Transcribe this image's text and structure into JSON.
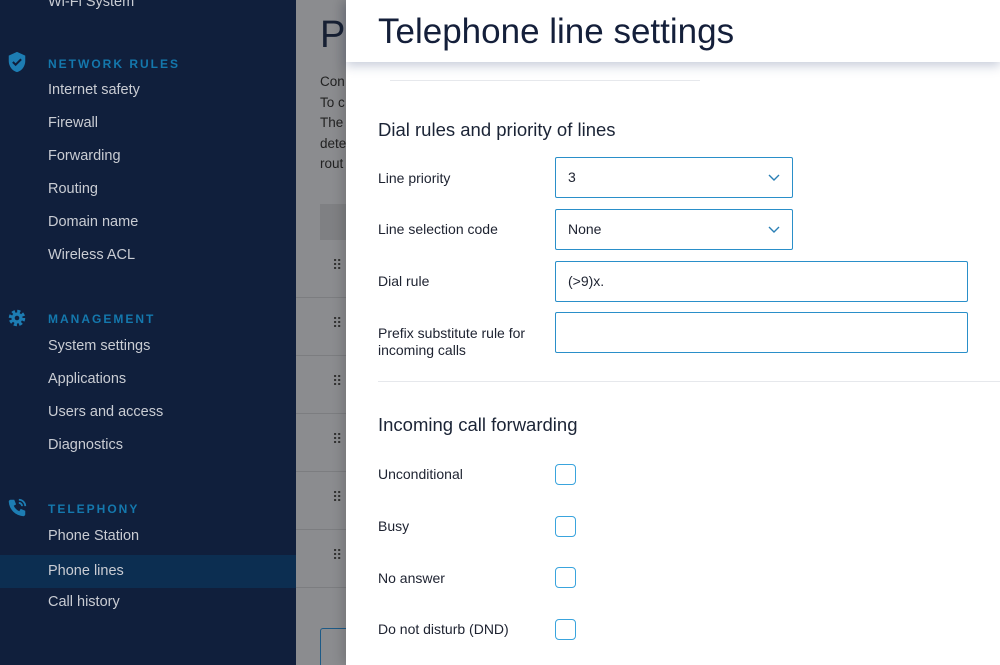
{
  "sidebar": {
    "partial_item": "Wi-Fi System",
    "sections": [
      {
        "title": "NETWORK RULES",
        "icon": "shield-check-icon",
        "items": [
          "Internet safety",
          "Firewall",
          "Forwarding",
          "Routing",
          "Domain name",
          "Wireless ACL"
        ]
      },
      {
        "title": "MANAGEMENT",
        "icon": "gear-icon",
        "items": [
          "System settings",
          "Applications",
          "Users and access",
          "Diagnostics"
        ]
      },
      {
        "title": "TELEPHONY",
        "icon": "phone-call-icon",
        "items": [
          "Phone Station",
          "Phone lines",
          "Call history"
        ]
      }
    ],
    "active_item": "Phone lines"
  },
  "background_page": {
    "title_fragment": "P",
    "text_fragments": [
      "Con",
      "To c",
      "The",
      "dete",
      "rout"
    ]
  },
  "panel": {
    "title": "Telephone line settings",
    "dial_section": {
      "heading": "Dial rules and priority of lines",
      "line_priority_label": "Line priority",
      "line_priority_value": "3",
      "line_selection_label": "Line selection code",
      "line_selection_value": "None",
      "dial_rule_label": "Dial rule",
      "dial_rule_value": "(>9)x.",
      "prefix_label": "Prefix substitute rule for incoming calls",
      "prefix_value": ""
    },
    "forwarding_section": {
      "heading": "Incoming call forwarding",
      "options": [
        {
          "label": "Unconditional",
          "checked": false
        },
        {
          "label": "Busy",
          "checked": false
        },
        {
          "label": "No answer",
          "checked": false
        },
        {
          "label": "Do not disturb (DND)",
          "checked": false
        }
      ]
    }
  },
  "colors": {
    "sidebar_bg": "#101f3c",
    "accent": "#1478ad",
    "active_bg": "#0c2e51",
    "field_border": "#2a8fc9"
  }
}
